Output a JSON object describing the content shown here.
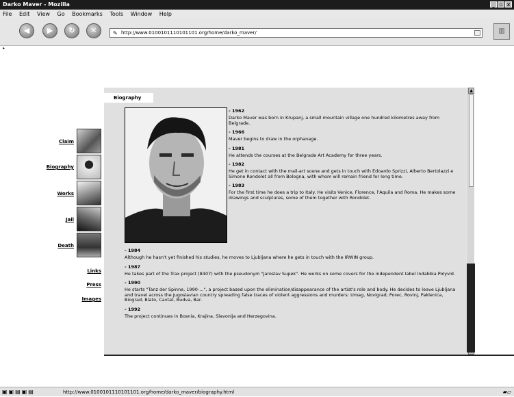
{
  "window": {
    "title": "Darko Maver - Mozilla",
    "controls": [
      "_",
      "▫",
      "×"
    ]
  },
  "menu": [
    "File",
    "Edit",
    "View",
    "Go",
    "Bookmarks",
    "Tools",
    "Window",
    "Help"
  ],
  "toolbar": {
    "back": "◀",
    "forward": "▶",
    "reload": "↻",
    "stop": "✕",
    "url": "http://www.0100101110101101.org/home/darko_maver/"
  },
  "sidebar": {
    "links": [
      "Claim",
      "Biography",
      "Works",
      "Jail",
      "Death",
      "Links",
      "Press",
      "Images"
    ]
  },
  "content": {
    "tab": "Biography",
    "entries": [
      {
        "year": "- 1962",
        "text": "Darko Maver was born in Krupanj, a small mountain village one hundred kilometres away from Belgrade."
      },
      {
        "year": "- 1966",
        "text": "Maver begins to draw in the orphanage."
      },
      {
        "year": "- 1981",
        "text": "He attends the courses at the Belgrade Art Academy for three years."
      },
      {
        "year": "- 1982",
        "text": "He get in contact with the mail-art scene and gets in touch with Edoardo Sprizzi, Alberto Bertolazzi e Simone Rondolet all from Bologna, with whom will remain friend for long time."
      },
      {
        "year": "- 1983",
        "text": "For the first time he does a trip to Italy. He visits Venice, Florence, l'Aquila and Roma. He makes some drawings and sculptures, some of them together with Rondolet."
      }
    ],
    "entries_full": [
      {
        "year": "- 1984",
        "text": "Although he hasn't yet finished his studies, he moves to Ljubljana where he gets in touch with the IRWIN group."
      },
      {
        "year": "- 1987",
        "text": "He takes part of the Trax project (8407) with the pseudonym \"Jaroslav Supek\". He works on some covers for the independent label Indabbia Polyvid."
      },
      {
        "year": "- 1990",
        "text": "He starts \"Tanz der Spinne, 1990-...\", a project based upon the elimination/disappearance of the artist's role and body. He decides to leave Ljubljana and travel across the Jugoslavian country spreading false traces of violent aggressions and murders: Umag, Novigrad, Porec, Rovinj, Paklenica, Biograd, Blato, Cavtat, Budva, Bar."
      },
      {
        "year": "- 1992",
        "text": "The project continues in Bosnia, Krajina, Slavonija and Herzegovina."
      }
    ]
  },
  "status": {
    "url": "http://www.0100101110101101.org/home/darko_maver/biography.html"
  }
}
